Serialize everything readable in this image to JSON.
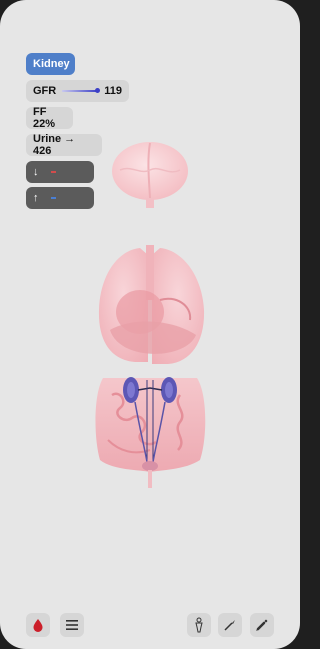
{
  "panel": {
    "organ_label": "Kidney",
    "gfr": {
      "label": "GFR",
      "value": "119"
    },
    "ff": {
      "text": "FF 22%"
    },
    "urine": {
      "text": "Urine → 426"
    },
    "down_symbol": "↓",
    "up_symbol": "↑"
  },
  "colors": {
    "accent": "#4f7fc9",
    "slider": "#3b3fc6",
    "down_mark": "#d24c4c",
    "up_mark": "#4a7fd4",
    "blood": "#cc1f2a"
  },
  "icons": {
    "blood-drop": "blood-drop-icon",
    "menu": "menu-icon",
    "body": "person-icon",
    "scalpel": "scalpel-icon",
    "syringe": "syringe-icon"
  }
}
